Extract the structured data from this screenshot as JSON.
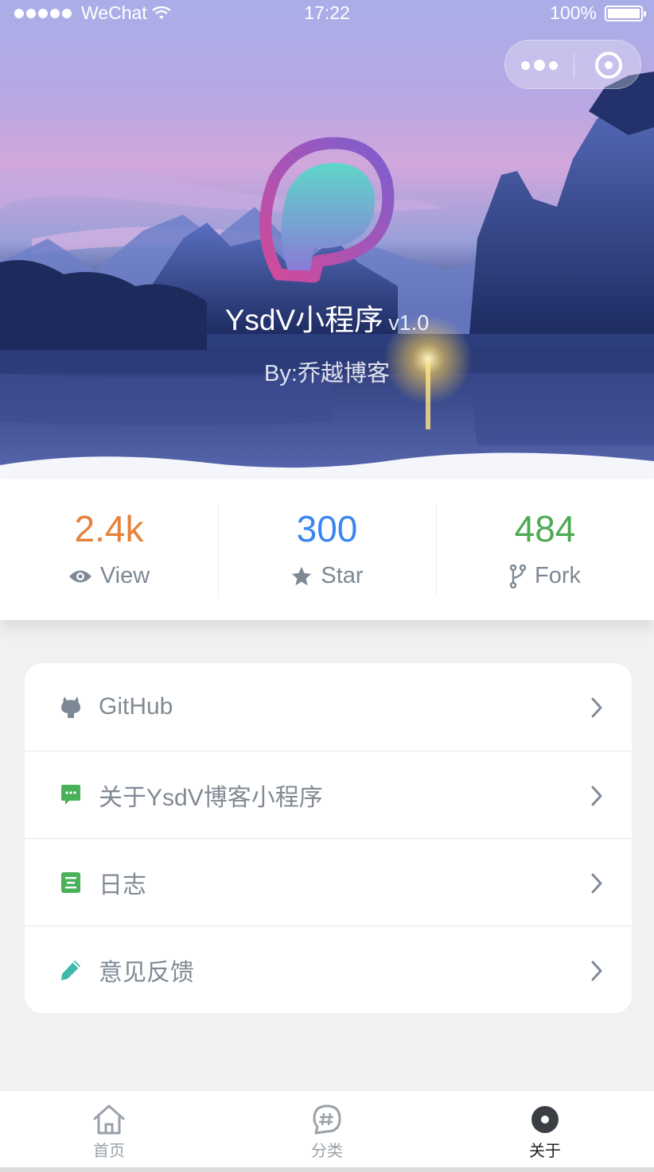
{
  "status_bar": {
    "carrier": "WeChat",
    "time": "17:22",
    "battery": "100%"
  },
  "capsule": {
    "more_icon": "more-dots-icon",
    "close_icon": "target-circle-icon"
  },
  "hero": {
    "title": "YsdV小程序",
    "version": "v1.0",
    "author": "By:乔越博客",
    "logo_icon": "p-logo-icon"
  },
  "stats": [
    {
      "value": "2.4k",
      "label": "View",
      "icon": "eye-icon",
      "color": "#e5823b"
    },
    {
      "value": "300",
      "label": "Star",
      "icon": "star-icon",
      "color": "#3a86f0"
    },
    {
      "value": "484",
      "label": "Fork",
      "icon": "fork-icon",
      "color": "#4caa52"
    }
  ],
  "menu": [
    {
      "label": "GitHub",
      "icon": "github-icon",
      "icon_color": "#7e8894"
    },
    {
      "label": "关于YsdV博客小程序",
      "icon": "chat-icon",
      "icon_color": "#49b15a"
    },
    {
      "label": "日志",
      "icon": "log-icon",
      "icon_color": "#49b15a"
    },
    {
      "label": "意见反馈",
      "icon": "pencil-icon",
      "icon_color": "#3cb9a9"
    }
  ],
  "tabbar": [
    {
      "label": "首页",
      "icon": "home-icon",
      "active": false
    },
    {
      "label": "分类",
      "icon": "hashtag-chat-icon",
      "active": false
    },
    {
      "label": "关于",
      "icon": "about-disc-icon",
      "active": true
    }
  ],
  "colors": {
    "view": "#e5823b",
    "star": "#3a86f0",
    "fork": "#4caa52",
    "text_muted": "#818a94",
    "background": "#f1f1f1"
  }
}
